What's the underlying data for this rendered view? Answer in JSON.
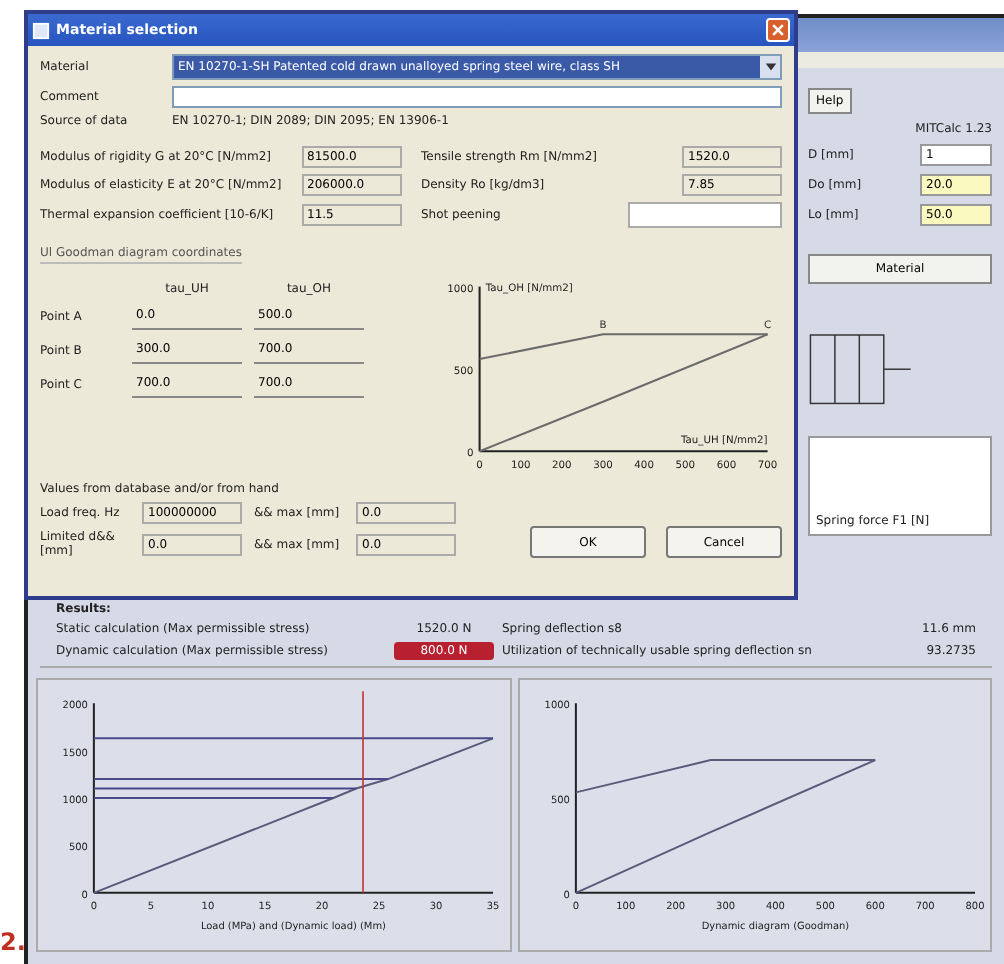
{
  "app": {
    "tool_button": "Help",
    "version": "MITCalc 1.23",
    "inputs": [
      {
        "label": "D [mm]",
        "value": "1",
        "highlighted": false
      },
      {
        "label": "Do [mm]",
        "value": "20.0",
        "highlighted": true
      },
      {
        "label": "Lo [mm]",
        "value": "50.0",
        "highlighted": true
      }
    ],
    "material_button": "Material",
    "list_item": "Spring force F1 [N]",
    "results": {
      "title": "Results:",
      "rows": [
        {
          "label": "Static calculation (Max permissible stress)",
          "value": "1520.0 N",
          "alert": false,
          "label_2": "Spring deflection s8",
          "value_2": "11.6 mm"
        },
        {
          "label": "Dynamic calculation (Max permissible stress)",
          "value": "800.0 N",
          "alert": true,
          "label_2": "Utilization of technically usable spring deflection sn",
          "value_2": "93.2735"
        }
      ]
    },
    "charts": [
      {
        "chart_data": {
          "type": "line",
          "xlabel": "Load (MPa) and (Dynamic load) (Mm)",
          "x": [
            0,
            21,
            23,
            25.8,
            35
          ],
          "series": [
            {
              "color": "#5a5a7a",
              "values": [
                0,
                1000,
                1100,
                1200,
                1630
              ]
            },
            {
              "color": "#4a4a8a",
              "values": [
                1630,
                1630,
                1630,
                1630,
                1630
              ]
            },
            {
              "color": "#4a4a8a",
              "values": [
                1200,
                1200,
                1200,
                1200,
                null
              ]
            },
            {
              "color": "#4a4a8a",
              "values": [
                1100,
                1100,
                1100,
                null,
                null
              ]
            },
            {
              "color": "#4a4a8a",
              "values": [
                1000,
                1000,
                null,
                null,
                null
              ]
            }
          ],
          "xlim": [
            0,
            35
          ],
          "ylim": [
            0,
            2000
          ],
          "xticks": [
            0,
            5,
            10,
            15,
            20,
            25,
            30,
            35
          ],
          "yticks": [
            0,
            500,
            1000,
            1500,
            2000
          ],
          "ref_lines": [
            {
              "axis": "x",
              "value": 23.6,
              "color": "#c83030"
            }
          ]
        }
      },
      {
        "chart_data": {
          "type": "line",
          "xlabel": "Dynamic diagram (Goodman)",
          "x": [
            0,
            270,
            600
          ],
          "series": [
            {
              "color": "#5a5a7a",
              "values": [
                530,
                700,
                700
              ]
            },
            {
              "color": "#5a5a7a",
              "values": [
                0,
                320,
                700
              ]
            }
          ],
          "xlim": [
            0,
            800
          ],
          "ylim": [
            0,
            1000
          ],
          "xticks": [
            0,
            100,
            200,
            300,
            400,
            500,
            600,
            700,
            800
          ],
          "yticks": [
            0,
            500,
            1000
          ]
        }
      }
    ]
  },
  "dialog": {
    "title": "Material selection",
    "material": {
      "label": "Material",
      "value": "EN 10270-1-SH Patented cold drawn unalloyed spring steel wire, class SH"
    },
    "comment": {
      "label": "Comment"
    },
    "source": {
      "label": "Source of data",
      "value": "EN 10270-1; DIN 2089; DIN 2095; EN 13906-1"
    },
    "fields": [
      {
        "label": "Modulus of rigidity G at 20°C [N/mm2]",
        "value": "81500.0"
      },
      {
        "label": "Tensile strength Rm [N/mm2]",
        "value": "1520.0"
      },
      {
        "label": "Modulus of elasticity E at 20°C [N/mm2]",
        "value": "206000.0"
      },
      {
        "label": "Density Ro [kg/dm3]",
        "value": "7.85"
      },
      {
        "label": "Thermal expansion coefficient [10-6/K]",
        "value": "11.5"
      },
      {
        "label": "Shot peening"
      }
    ],
    "section": "Ul   Goodman diagram coordinates",
    "table": {
      "columns": [
        "tau_UH",
        "tau_OH"
      ],
      "rows": [
        {
          "name": "Point A",
          "cells": [
            "0.0",
            "500.0"
          ]
        },
        {
          "name": "Point B",
          "cells": [
            "300.0",
            "700.0"
          ]
        },
        {
          "name": "Point C",
          "cells": [
            "700.0",
            "700.0"
          ]
        }
      ]
    },
    "chart_data": {
      "type": "line",
      "xlabel": "Tau_UH [N/mm2]",
      "ylabel": "Tau_OH [N/mm2]",
      "x": [
        0,
        300,
        700
      ],
      "series": [
        {
          "color": "#6a6a6a",
          "values": [
            560,
            710,
            710
          ]
        },
        {
          "color": "#6a6a6a",
          "values": [
            0,
            300,
            710
          ]
        }
      ],
      "xlim": [
        0,
        700
      ],
      "ylim": [
        0,
        1000
      ],
      "xticks": [
        0,
        100,
        200,
        300,
        400,
        500,
        600,
        700
      ],
      "yticks": [
        0,
        500,
        1000
      ],
      "annotations": [
        {
          "text": "B",
          "x": 300,
          "y": 710
        },
        {
          "text": "C",
          "x": 700,
          "y": 710
        }
      ]
    },
    "values_note": "Values from database and/or from hand",
    "extra": [
      {
        "label": "Load freq. Hz",
        "value": "100000000"
      },
      {
        "label": "&& max [mm]",
        "value": "0.0"
      },
      {
        "label": "Limited d&& [mm]",
        "value": "0.0"
      },
      {
        "label": "&& max [mm]",
        "value": "0.0"
      }
    ],
    "buttons": [
      "OK",
      "Cancel"
    ]
  },
  "figure_label": "2."
}
